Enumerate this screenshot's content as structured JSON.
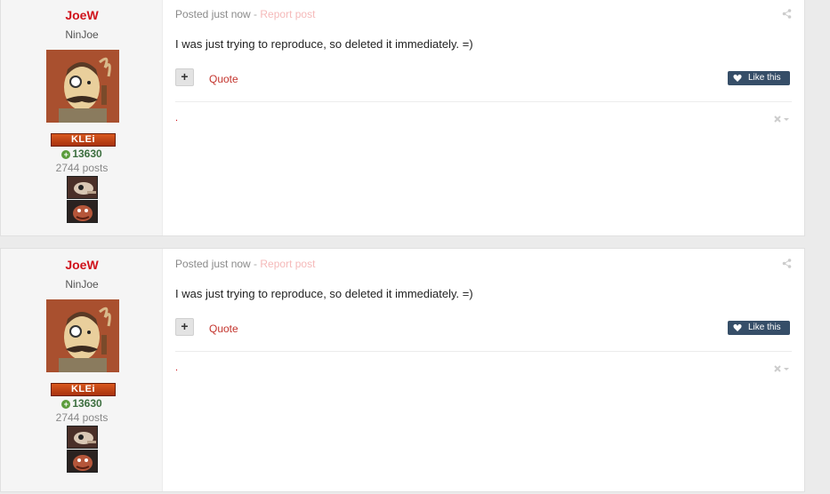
{
  "posts": [
    {
      "author": {
        "name": "JoeW",
        "title": "NinJoe",
        "badge": "KLEi",
        "reputation": "13630",
        "post_count": "2744 posts"
      },
      "meta": {
        "posted": "Posted just now",
        "separator": " - ",
        "report": "Report post"
      },
      "body": "I was just trying to reproduce, so deleted it immediately. =)",
      "actions": {
        "multiquote": "+",
        "quote": "Quote",
        "like": "Like this"
      },
      "signature_link": "."
    },
    {
      "author": {
        "name": "JoeW",
        "title": "NinJoe",
        "badge": "KLEi",
        "reputation": "13630",
        "post_count": "2744 posts"
      },
      "meta": {
        "posted": "Posted just now",
        "separator": " - ",
        "report": "Report post"
      },
      "body": "I was just trying to reproduce, so deleted it immediately. =)",
      "actions": {
        "multiquote": "+",
        "quote": "Quote",
        "like": "Like this"
      },
      "signature_link": "."
    }
  ],
  "colors": {
    "author_name": "#d0121b",
    "quote_link": "#c3342d",
    "like_button": "#364e68",
    "reputation": "#3c6e3f",
    "badge": "#c2441a"
  },
  "icons": [
    "share-icon",
    "heart-icon",
    "reputation-plus-icon",
    "signature-tools-icon"
  ]
}
